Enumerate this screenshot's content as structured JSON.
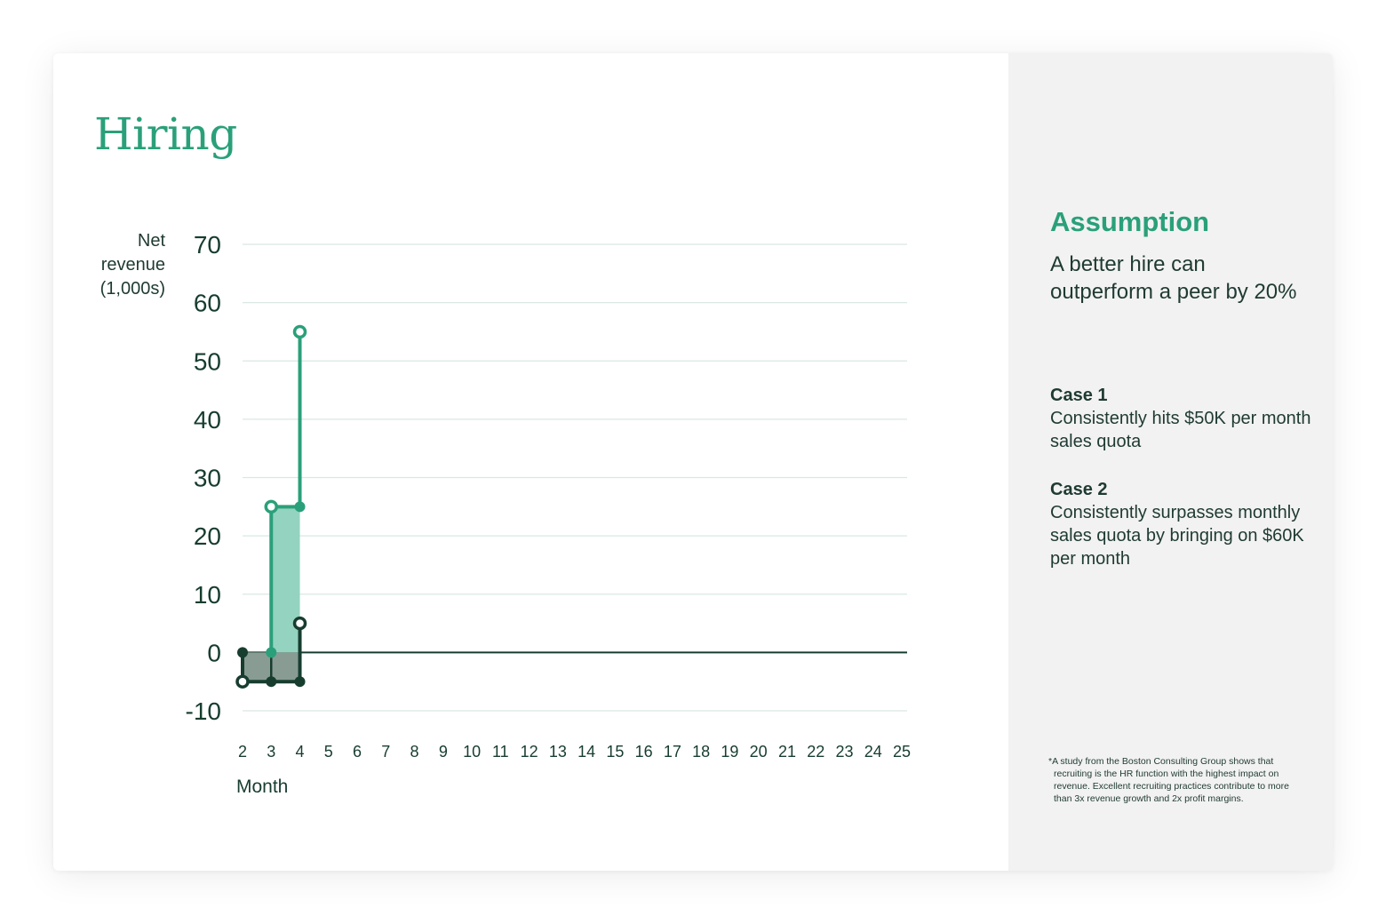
{
  "title": "Hiring",
  "ylabel_lines": [
    "Net",
    "revenue",
    "(1,000s)"
  ],
  "assumption": {
    "title": "Assumption",
    "body": "A better hire can outperform a peer by 20%"
  },
  "cases": [
    {
      "title": "Case 1",
      "body": "Consistently hits $50K per month sales quota"
    },
    {
      "title": "Case 2",
      "body": "Consistently surpasses monthly sales quota by bringing on $60K per month"
    }
  ],
  "footnote": "*A study from the Boston Consulting Group shows that recruiting is the HR function with the highest impact on revenue. Excellent recruiting practices contribute to more than 3x revenue growth and 2x profit margins.",
  "colors": {
    "accent": "#2aa07a",
    "dark": "#173d2f",
    "light_fill": "#93d3bf",
    "dark_fill": "#889c94",
    "grid": "#d9e8e3"
  },
  "chart_data": {
    "type": "line",
    "xlabel": "Month",
    "ylabel": "Net revenue (1,000s)",
    "x_ticks": [
      2,
      3,
      4,
      5,
      6,
      7,
      8,
      9,
      10,
      11,
      12,
      13,
      14,
      15,
      16,
      17,
      18,
      19,
      20,
      21,
      22,
      23,
      24,
      25
    ],
    "y_ticks": [
      70,
      60,
      50,
      40,
      30,
      20,
      10,
      0,
      -10
    ],
    "xlim": [
      2,
      25
    ],
    "ylim": [
      -10,
      70
    ],
    "grid": true,
    "series": [
      {
        "color": "accent",
        "points": [
          [
            3,
            0
          ],
          [
            3,
            25
          ],
          [
            4,
            25
          ],
          [
            4,
            55
          ]
        ],
        "open_points": [
          [
            3,
            25
          ],
          [
            4,
            55
          ]
        ],
        "filled_points": [
          [
            3,
            0
          ],
          [
            4,
            25
          ]
        ],
        "fill_region": [
          3,
          4,
          0,
          25
        ]
      },
      {
        "color": "dark",
        "points": [
          [
            2,
            0
          ],
          [
            2,
            -5
          ],
          [
            4,
            -5
          ],
          [
            4,
            5
          ]
        ],
        "open_points": [
          [
            2,
            -5
          ],
          [
            4,
            5
          ]
        ],
        "filled_points": [
          [
            2,
            0
          ],
          [
            3,
            -5
          ],
          [
            4,
            -5
          ]
        ],
        "fill_region": [
          2,
          4,
          -5,
          0
        ],
        "divider_x": 3
      }
    ]
  }
}
